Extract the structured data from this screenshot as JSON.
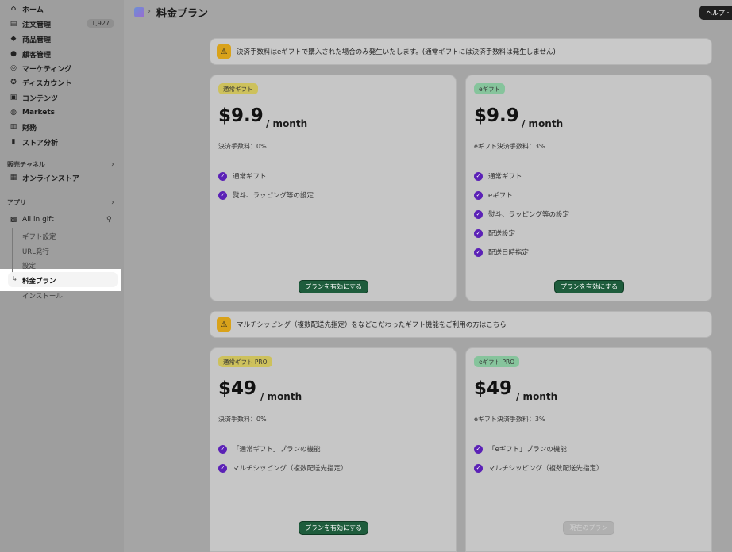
{
  "sidebar": {
    "main_items": [
      {
        "label": "ホーム",
        "icon": "home-icon"
      },
      {
        "label": "注文管理",
        "icon": "inbox-icon",
        "count": "1,927"
      },
      {
        "label": "商品管理",
        "icon": "tag-icon"
      },
      {
        "label": "顧客管理",
        "icon": "person-icon"
      },
      {
        "label": "マーケティング",
        "icon": "target-icon"
      },
      {
        "label": "ディスカウント",
        "icon": "discount-icon"
      },
      {
        "label": "コンテンツ",
        "icon": "content-icon"
      },
      {
        "label": "Markets",
        "icon": "globe-icon"
      },
      {
        "label": "財務",
        "icon": "bank-icon"
      },
      {
        "label": "ストア分析",
        "icon": "chart-icon"
      }
    ],
    "sales_channel_heading": "販売チャネル",
    "online_store": "オンラインストア",
    "apps_heading": "アプリ",
    "app_name": "All in gift",
    "app_sub_items": [
      "ギフト設定",
      "URL発行",
      "設定",
      "料金プラン",
      "インストール"
    ]
  },
  "header": {
    "title": "料金プラン",
    "help_label": "ヘルプ・"
  },
  "banners": {
    "fee_notice": "決済手数料はeギフトで購入された場合のみ発生いたします。(通常ギフトには決済手数料は発生しません)",
    "pro_notice": "マルチシッピング（複数配送先指定）をなどこだわったギフト機能をご利用の方はこちら"
  },
  "plans": [
    {
      "tag": "通常ギフト",
      "price": "$9.9",
      "per": "/ month",
      "fee": "決済手数料：0%",
      "features": [
        "通常ギフト",
        "熨斗、ラッピング等の設定"
      ],
      "button": "プランを有効にする"
    },
    {
      "tag": "eギフト",
      "price": "$9.9",
      "per": "/ month",
      "fee": "eギフト決済手数料：3%",
      "features": [
        "通常ギフト",
        "eギフト",
        "熨斗、ラッピング等の設定",
        "配送設定",
        "配送日時指定"
      ],
      "button": "プランを有効にする"
    },
    {
      "tag": "通常ギフト PRO",
      "price": "$49",
      "per": "/ month",
      "fee": "決済手数料：0%",
      "features": [
        "「通常ギフト」プランの機能",
        "マルチシッピング（複数配送先指定）"
      ],
      "button": "プランを有効にする"
    },
    {
      "tag": "eギフト PRO",
      "price": "$49",
      "per": "/ month",
      "fee": "eギフト決済手数料：3%",
      "features": [
        "「eギフト」プランの機能",
        "マルチシッピング（複数配送先指定）"
      ],
      "button": "現在のプラン"
    }
  ],
  "colors": {
    "accent_check": "#5b21b6",
    "primary_button": "#1e5c3c",
    "warning": "#d9a21a"
  }
}
